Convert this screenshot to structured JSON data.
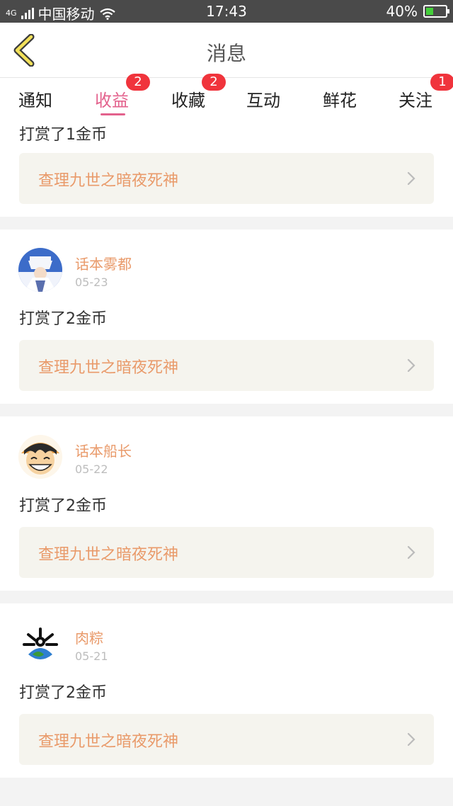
{
  "status_bar": {
    "network": "4G",
    "carrier": "中国移动",
    "time": "17:43",
    "battery_percent": "40%",
    "battery_level": 0.4
  },
  "header": {
    "title": "消息",
    "back_icon": "chevron-left-icon"
  },
  "tabs": [
    {
      "label": "通知",
      "badge": ""
    },
    {
      "label": "收益",
      "badge": "2",
      "active": true
    },
    {
      "label": "收藏",
      "badge": "2"
    },
    {
      "label": "互动",
      "badge": ""
    },
    {
      "label": "鲜花",
      "badge": ""
    },
    {
      "label": "关注",
      "badge": "1"
    }
  ],
  "messages": [
    {
      "action": "打赏了1金币",
      "link": "查理九世之暗夜死神"
    },
    {
      "user": "话本雾都",
      "date": "05-23",
      "action": "打赏了2金币",
      "link": "查理九世之暗夜死神"
    },
    {
      "user": "话本船长",
      "date": "05-22",
      "action": "打赏了2金币",
      "link": "查理九世之暗夜死神"
    },
    {
      "user": "肉粽",
      "date": "05-21",
      "action": "打赏了2金币",
      "link": "查理九世之暗夜死神"
    }
  ],
  "colors": {
    "accent": "#e3628d",
    "badge": "#f0343c",
    "link_text": "#e99a6a",
    "link_bg": "#f5f4ee",
    "back_arrow": "#f3e15a"
  }
}
